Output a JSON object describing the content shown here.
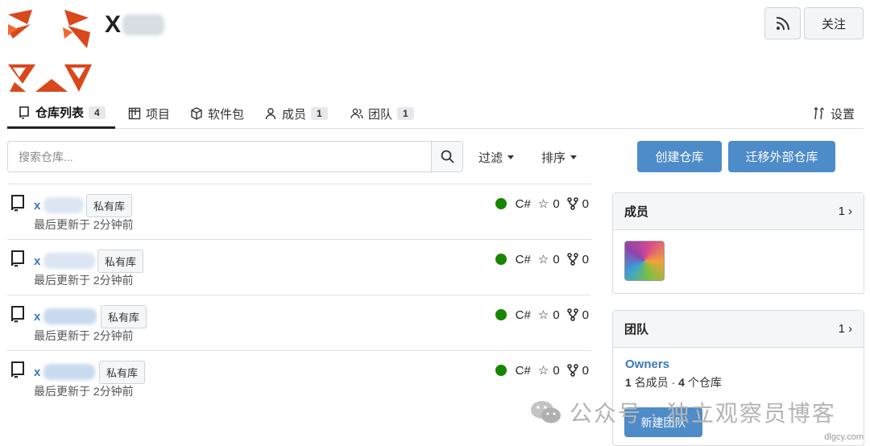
{
  "header": {
    "org_name": "X",
    "rss_icon": "rss-icon",
    "follow_label": "关注"
  },
  "tabs": [
    {
      "label": "仓库列表",
      "count": "4",
      "icon": "repo-icon"
    },
    {
      "label": "项目",
      "count": "",
      "icon": "project-icon"
    },
    {
      "label": "软件包",
      "count": "",
      "icon": "package-icon"
    },
    {
      "label": "成员",
      "count": "1",
      "icon": "person-icon"
    },
    {
      "label": "团队",
      "count": "1",
      "icon": "people-icon"
    }
  ],
  "settings_label": "设置",
  "search": {
    "placeholder": "搜索仓库..."
  },
  "filter_label": "过滤",
  "sort_label": "排序",
  "actions": {
    "create_repo": "创建仓库",
    "migrate_repo": "迁移外部仓库"
  },
  "repos": [
    {
      "name": "x",
      "badge": "私有库",
      "updated": "最后更新于 2分钟前",
      "lang": "C#",
      "stars": "0",
      "forks": "0"
    },
    {
      "name": "x",
      "badge": "私有库",
      "updated": "最后更新于 2分钟前",
      "lang": "C#",
      "stars": "0",
      "forks": "0"
    },
    {
      "name": "x",
      "badge": "私有库",
      "updated": "最后更新于 2分钟前",
      "lang": "C#",
      "stars": "0",
      "forks": "0"
    },
    {
      "name": "x",
      "badge": "私有库",
      "updated": "最后更新于 2分钟前",
      "lang": "C#",
      "stars": "0",
      "forks": "0"
    }
  ],
  "colors": {
    "lang_csharp": "#178600",
    "primary": "#4d8bc9",
    "link": "#3a77c0"
  },
  "members_panel": {
    "title": "成员",
    "count": "1"
  },
  "teams_panel": {
    "title": "团队",
    "count": "1",
    "team_name": "Owners",
    "member_count": "1",
    "member_suffix": "名成员 ·",
    "repo_count": "4",
    "repo_suffix": "个仓库",
    "new_team_label": "新建团队"
  },
  "watermark": {
    "text": "公众号 · 独立观察员博客"
  },
  "site": "dlgcy.com"
}
